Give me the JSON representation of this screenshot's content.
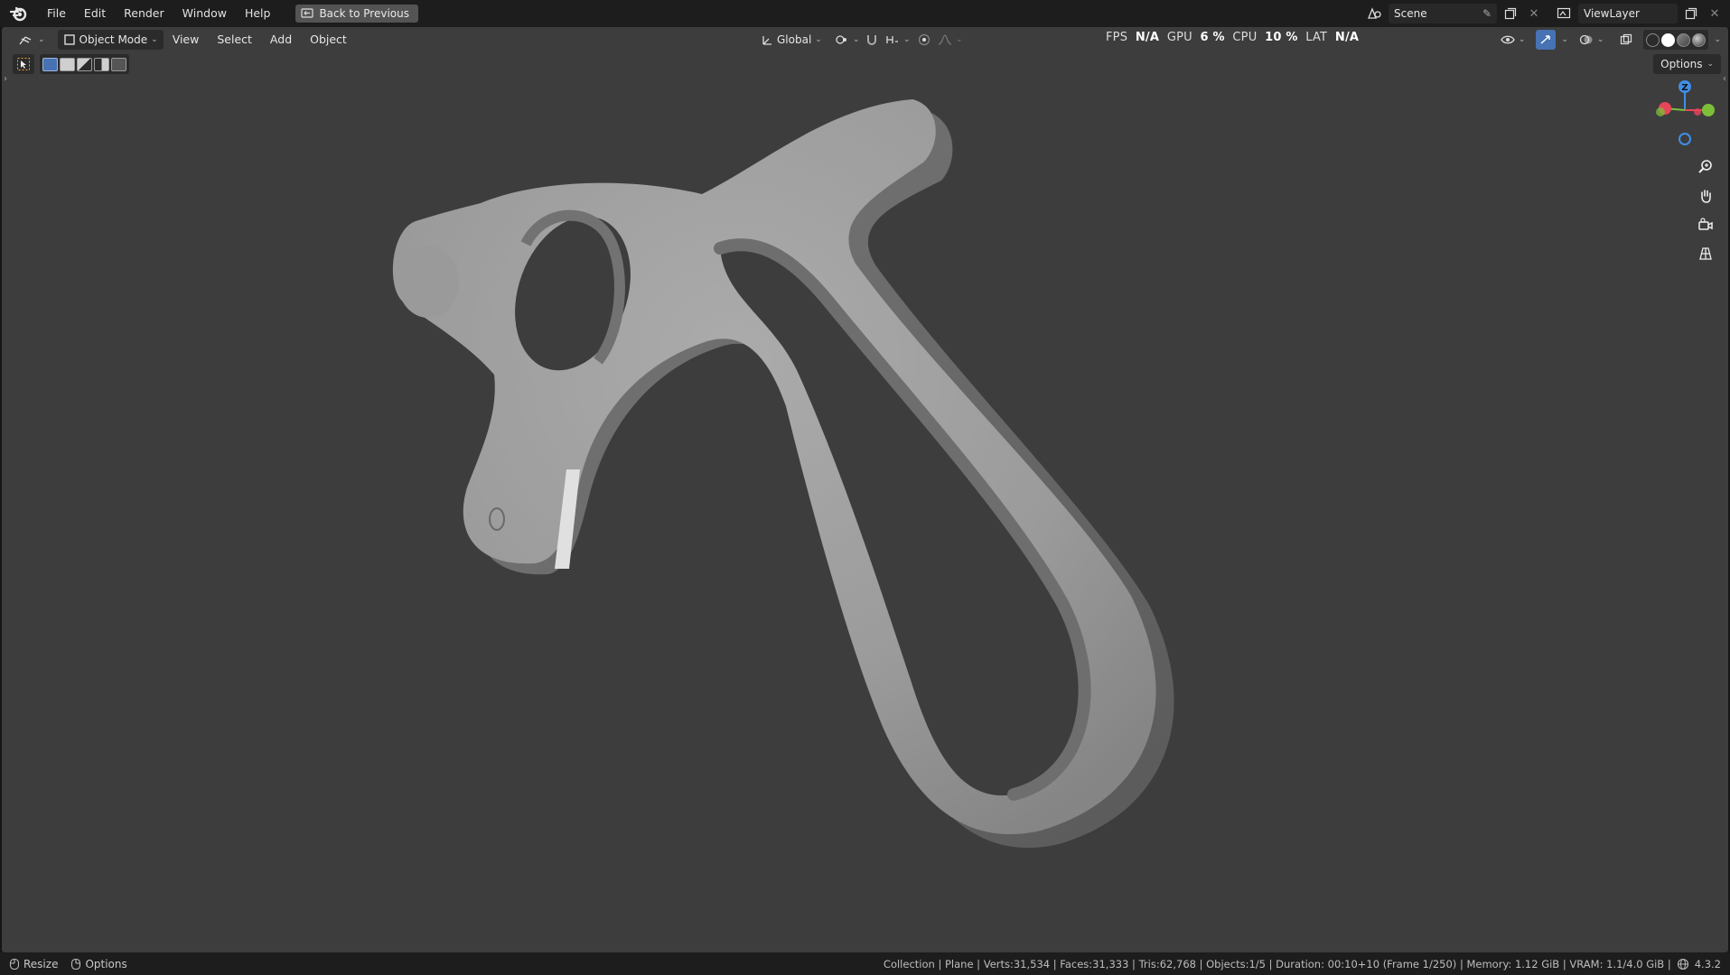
{
  "topbar": {
    "menus": [
      "File",
      "Edit",
      "Render",
      "Window",
      "Help"
    ],
    "back_button": "Back to Previous",
    "scene": "Scene",
    "view_layer": "ViewLayer"
  },
  "viewport_header": {
    "mode": "Object Mode",
    "menus": [
      "View",
      "Select",
      "Add",
      "Object"
    ],
    "orientation": "Global",
    "options": "Options"
  },
  "overlay_stats": {
    "fps_label": "FPS",
    "fps_value": "N/A",
    "gpu_label": "GPU",
    "gpu_value": "6 %",
    "cpu_label": "CPU",
    "cpu_value": "10 %",
    "lat_label": "LAT",
    "lat_value": "N/A"
  },
  "gizmo": {
    "z_label": "Z",
    "x_color": "#e8455a",
    "y_color": "#7cc038",
    "z_color": "#3f8fe6"
  },
  "statusbar": {
    "left": [
      "Resize",
      "Options"
    ],
    "info": "Collection | Plane | Verts:31,534 | Faces:31,333 | Tris:62,768 | Objects:1/5 | Duration: 00:10+10 (Frame 1/250) | Memory: 1.12 GiB | VRAM: 1.1/4.0 GiB |",
    "version": "4.3.2"
  },
  "colors": {
    "viewport_bg": "#3d3d3d",
    "model": "#a6a6a6",
    "accent_blue": "#4772b3"
  }
}
